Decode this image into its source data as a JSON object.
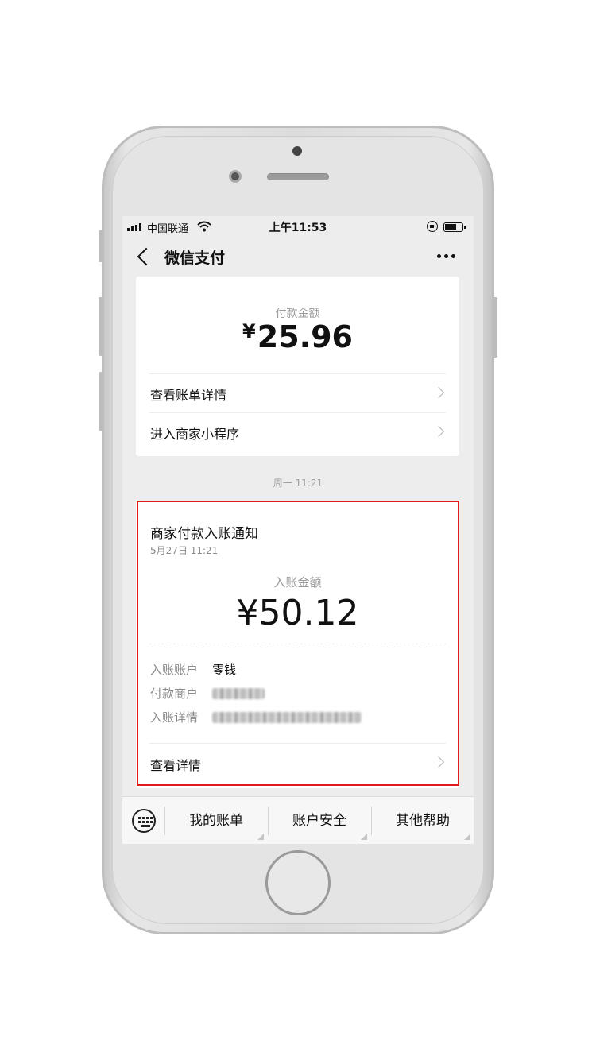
{
  "status_bar": {
    "carrier": "中国联通",
    "time": "上午11:53"
  },
  "nav": {
    "title": "微信支付"
  },
  "payment_card": {
    "label": "付款金额",
    "currency": "¥",
    "amount": "25.96",
    "rows": [
      {
        "label": "查看账单详情"
      },
      {
        "label": "进入商家小程序"
      }
    ]
  },
  "timestamp": "周一 11:21",
  "notice_card": {
    "title": "商家付款入账通知",
    "time": "5月27日 11:21",
    "amount_label": "入账金额",
    "amount": "¥50.12",
    "fields": [
      {
        "key": "入账账户",
        "value": "零钱"
      },
      {
        "key": "付款商户",
        "value": ""
      },
      {
        "key": "入账详情",
        "value": ""
      }
    ],
    "detail_label": "查看详情"
  },
  "bottom_menu": {
    "items": [
      "我的账单",
      "账户安全",
      "其他帮助"
    ]
  },
  "colors": {
    "highlight": "#e11b1b",
    "background": "#ededed"
  },
  "icons": [
    "back-icon",
    "more-icon",
    "chevron-right-icon",
    "keyboard-icon",
    "wifi-icon",
    "battery-icon",
    "orientation-lock-icon"
  ]
}
